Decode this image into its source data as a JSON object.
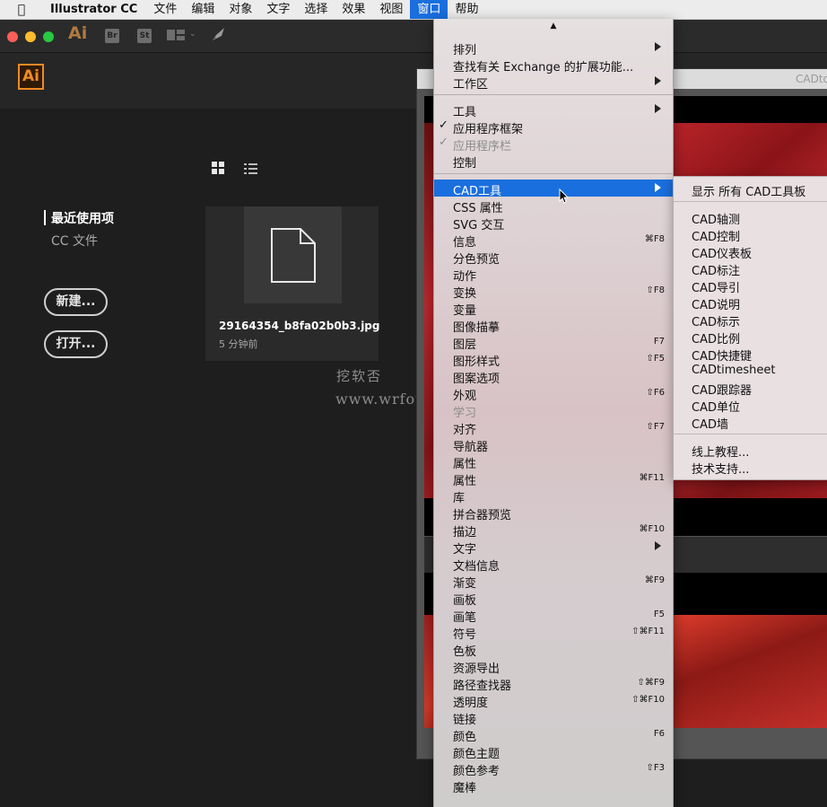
{
  "menubar": {
    "app_name": "Illustrator CC",
    "items": [
      "文件",
      "编辑",
      "对象",
      "文字",
      "选择",
      "效果",
      "视图",
      "窗口",
      "帮助"
    ],
    "active": "窗口"
  },
  "appbar": {
    "ai_text": "Ai",
    "bridge_label": "Br",
    "stock_label": "St"
  },
  "home": {
    "logo_text": "Ai",
    "sidebar_active": "最近使用项",
    "sidebar_cc": "CC 文件",
    "new_button": "新建...",
    "open_button": "打开...",
    "recent_file": {
      "name": "29164354_b8fa02b0b3.jpg",
      "time": "5 分钟前"
    }
  },
  "watermark": {
    "line1": "挖软否",
    "line2": "www.wrfou.com"
  },
  "background_window": {
    "title": "CADtoo"
  },
  "window_menu": {
    "items": [
      {
        "label": "排列",
        "shortcut": "",
        "submenu": true
      },
      {
        "label": "查找有关 Exchange 的扩展功能...",
        "shortcut": "",
        "submenu": false
      },
      {
        "label": "工作区",
        "shortcut": "",
        "submenu": true
      },
      {
        "label": "工具",
        "shortcut": "",
        "submenu": true
      },
      {
        "label": "应用程序框架",
        "shortcut": "",
        "submenu": false,
        "checked": true
      },
      {
        "label": "应用程序栏",
        "shortcut": "",
        "submenu": false,
        "checked": true,
        "disabled": true
      },
      {
        "label": "控制",
        "shortcut": "",
        "submenu": false
      },
      {
        "label": "CAD工具",
        "shortcut": "",
        "submenu": true,
        "highlighted": true
      },
      {
        "label": "CSS 属性",
        "shortcut": "",
        "submenu": false
      },
      {
        "label": "SVG 交互",
        "shortcut": "",
        "submenu": false
      },
      {
        "label": "信息",
        "shortcut": "⌘F8",
        "submenu": false
      },
      {
        "label": "分色预览",
        "shortcut": "",
        "submenu": false
      },
      {
        "label": "动作",
        "shortcut": "",
        "submenu": false
      },
      {
        "label": "变换",
        "shortcut": "⇧F8",
        "submenu": false
      },
      {
        "label": "变量",
        "shortcut": "",
        "submenu": false
      },
      {
        "label": "图像描摹",
        "shortcut": "",
        "submenu": false
      },
      {
        "label": "图层",
        "shortcut": "F7",
        "submenu": false
      },
      {
        "label": "图形样式",
        "shortcut": "⇧F5",
        "submenu": false
      },
      {
        "label": "图案选项",
        "shortcut": "",
        "submenu": false
      },
      {
        "label": "外观",
        "shortcut": "⇧F6",
        "submenu": false
      },
      {
        "label": "学习",
        "shortcut": "",
        "submenu": false,
        "disabled": true
      },
      {
        "label": "对齐",
        "shortcut": "⇧F7",
        "submenu": false
      },
      {
        "label": "导航器",
        "shortcut": "",
        "submenu": false
      },
      {
        "label": "属性",
        "shortcut": "",
        "submenu": false
      },
      {
        "label": "属性",
        "shortcut": "⌘F11",
        "submenu": false
      },
      {
        "label": "库",
        "shortcut": "",
        "submenu": false
      },
      {
        "label": "拼合器预览",
        "shortcut": "",
        "submenu": false
      },
      {
        "label": "描边",
        "shortcut": "⌘F10",
        "submenu": false
      },
      {
        "label": "文字",
        "shortcut": "",
        "submenu": true
      },
      {
        "label": "文档信息",
        "shortcut": "",
        "submenu": false
      },
      {
        "label": "渐变",
        "shortcut": "⌘F9",
        "submenu": false
      },
      {
        "label": "画板",
        "shortcut": "",
        "submenu": false
      },
      {
        "label": "画笔",
        "shortcut": "F5",
        "submenu": false
      },
      {
        "label": "符号",
        "shortcut": "⇧⌘F11",
        "submenu": false
      },
      {
        "label": "色板",
        "shortcut": "",
        "submenu": false
      },
      {
        "label": "资源导出",
        "shortcut": "",
        "submenu": false
      },
      {
        "label": "路径查找器",
        "shortcut": "⇧⌘F9",
        "submenu": false
      },
      {
        "label": "透明度",
        "shortcut": "⇧⌘F10",
        "submenu": false
      },
      {
        "label": "链接",
        "shortcut": "",
        "submenu": false
      },
      {
        "label": "颜色",
        "shortcut": "F6",
        "submenu": false
      },
      {
        "label": "颜色主题",
        "shortcut": "",
        "submenu": false
      },
      {
        "label": "颜色参考",
        "shortcut": "⇧F3",
        "submenu": false
      },
      {
        "label": "魔棒",
        "shortcut": "",
        "submenu": false
      }
    ]
  },
  "cad_submenu": {
    "items": [
      "显示 所有 CAD工具板",
      "CAD轴测",
      "CAD控制",
      "CAD仪表板",
      "CAD标注",
      "CAD导引",
      "CAD说明",
      "CAD标示",
      "CAD比例",
      "CAD快捷键",
      "CADtimesheet",
      "CAD跟踪器",
      "CAD单位",
      "CAD墙",
      "线上教程...",
      "技术支持..."
    ]
  },
  "colors": {
    "highlight": "#1a6fde",
    "ai_orange": "#f08a24",
    "dark_bg": "#1e1e1e"
  }
}
